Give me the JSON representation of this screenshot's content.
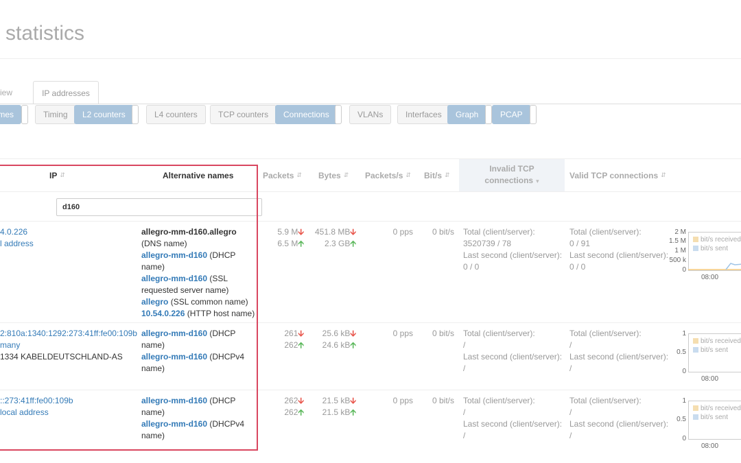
{
  "page": {
    "title": "statistics"
  },
  "tabs": [
    {
      "label": "view",
      "active": false
    },
    {
      "label": "IP addresses",
      "active": true
    }
  ],
  "toolbar": {
    "buttons": [
      {
        "label": "mes",
        "on": true
      },
      {
        "label": "Timing",
        "on": false
      },
      {
        "label": "L2 counters",
        "on": true
      },
      {
        "label": "L4 counters",
        "on": false
      },
      {
        "label": "TCP counters",
        "on": false
      },
      {
        "label": "Connections",
        "on": true
      },
      {
        "label": "VLANs",
        "on": false
      },
      {
        "label": "Interfaces",
        "on": false
      },
      {
        "label": "Graph",
        "on": true
      },
      {
        "label": "PCAP",
        "on": true
      }
    ]
  },
  "table": {
    "headers": {
      "ip": "IP",
      "alt_names": "Alternative names",
      "packets": "Packets",
      "bytes": "Bytes",
      "packets_s": "Packets/s",
      "bits_s": "Bit/s",
      "invalid_tcp_1": "Invalid TCP",
      "invalid_tcp_2": "connections",
      "valid_tcp": "Valid TCP connections"
    },
    "filter": {
      "value": "d160"
    },
    "rows": [
      {
        "ip": "4.0.226",
        "ip_note": "l address",
        "ip_extra": "",
        "alt": [
          {
            "bold": "allegro-mm-d160.allegro",
            "rest": "",
            "bold_link": false
          },
          {
            "bold": "",
            "rest": "(DNS name)",
            "bold_link": false
          },
          {
            "bold": "allegro-mm-d160",
            "rest": " (DHCP",
            "bold_link": true
          },
          {
            "bold": "",
            "rest": "name)",
            "bold_link": false
          },
          {
            "bold": "allegro-mm-d160",
            "rest": " (SSL",
            "bold_link": true
          },
          {
            "bold": "",
            "rest": "requested server name)",
            "bold_link": false
          },
          {
            "bold": "allegro",
            "rest": " (SSL common name)",
            "bold_link": true
          },
          {
            "bold": "10.54.0.226",
            "rest": " (HTTP host name)",
            "bold_link": true
          }
        ],
        "packets_rx": "5.9 M",
        "packets_tx": "6.5 M",
        "bytes_rx": "451.8 MB",
        "bytes_tx": "2.3 GB",
        "pps": "0 pps",
        "bits": "0 bit/s",
        "invalid_total_label": "Total (client/server):",
        "invalid_total": "3520739 / 78",
        "invalid_last_label": "Last second (client/server):",
        "invalid_last": "0 / 0",
        "valid_total_label": "Total (client/server):",
        "valid_total": "0 / 91",
        "valid_last_label": "Last second (client/server):",
        "valid_last": "0 / 0",
        "graph": {
          "y_ticks": [
            "2 M",
            "1.5 M",
            "1 M",
            "500 k",
            "0"
          ],
          "x_tick": "08:00",
          "legend_rx": "bit/s received",
          "legend_tx": "bit/s sent"
        }
      },
      {
        "ip": "2:810a:1340:1292:273:41ff:fe00:109b",
        "ip_note": "many",
        "ip_extra": "1334 KABELDEUTSCHLAND-AS",
        "alt": [
          {
            "bold": "allegro-mm-d160",
            "rest": " (DHCP",
            "bold_link": true
          },
          {
            "bold": "",
            "rest": "name)",
            "bold_link": false
          },
          {
            "bold": "allegro-mm-d160",
            "rest": " (DHCPv4",
            "bold_link": true
          },
          {
            "bold": "",
            "rest": "name)",
            "bold_link": false
          }
        ],
        "packets_rx": "261",
        "packets_tx": "262",
        "bytes_rx": "25.6 kB",
        "bytes_tx": "24.6 kB",
        "pps": "0 pps",
        "bits": "0 bit/s",
        "invalid_total_label": "Total (client/server):",
        "invalid_total": "/",
        "invalid_last_label": "Last second (client/server):",
        "invalid_last": "/",
        "valid_total_label": "Total (client/server):",
        "valid_total": "/",
        "valid_last_label": "Last second (client/server):",
        "valid_last": "/",
        "graph": {
          "y_ticks": [
            "1",
            "0.5",
            "0"
          ],
          "x_tick": "08:00",
          "legend_rx": "bit/s received",
          "legend_tx": "bit/s sent"
        }
      },
      {
        "ip": "::273:41ff:fe00:109b",
        "ip_note": "local address",
        "ip_extra": "",
        "alt": [
          {
            "bold": "allegro-mm-d160",
            "rest": " (DHCP",
            "bold_link": true
          },
          {
            "bold": "",
            "rest": "name)",
            "bold_link": false
          },
          {
            "bold": "allegro-mm-d160",
            "rest": " (DHCPv4",
            "bold_link": true
          },
          {
            "bold": "",
            "rest": "name)",
            "bold_link": false
          }
        ],
        "packets_rx": "262",
        "packets_tx": "262",
        "bytes_rx": "21.5 kB",
        "bytes_tx": "21.5 kB",
        "pps": "0 pps",
        "bits": "0 bit/s",
        "invalid_total_label": "Total (client/server):",
        "invalid_total": "/",
        "invalid_last_label": "Last second (client/server):",
        "invalid_last": "/",
        "valid_total_label": "Total (client/server):",
        "valid_total": "/",
        "valid_last_label": "Last second (client/server):",
        "valid_last": "/",
        "graph": {
          "y_ticks": [
            "1",
            "0.5",
            "0"
          ],
          "x_tick": "08:00",
          "legend_rx": "bit/s received",
          "legend_tx": "bit/s sent"
        }
      }
    ]
  },
  "icons": {
    "down": "arrow-down-icon",
    "up": "arrow-up-icon",
    "sort": "sort-icon",
    "sort_desc": "sort-desc-icon"
  },
  "colors": {
    "highlight": "#d9465f",
    "button_on": "#a9c4dc",
    "link": "#337ab7",
    "down": "#e8544a",
    "up": "#5cb85c",
    "legend_rx": "#f5deb0",
    "legend_tx": "#c9dcef"
  }
}
